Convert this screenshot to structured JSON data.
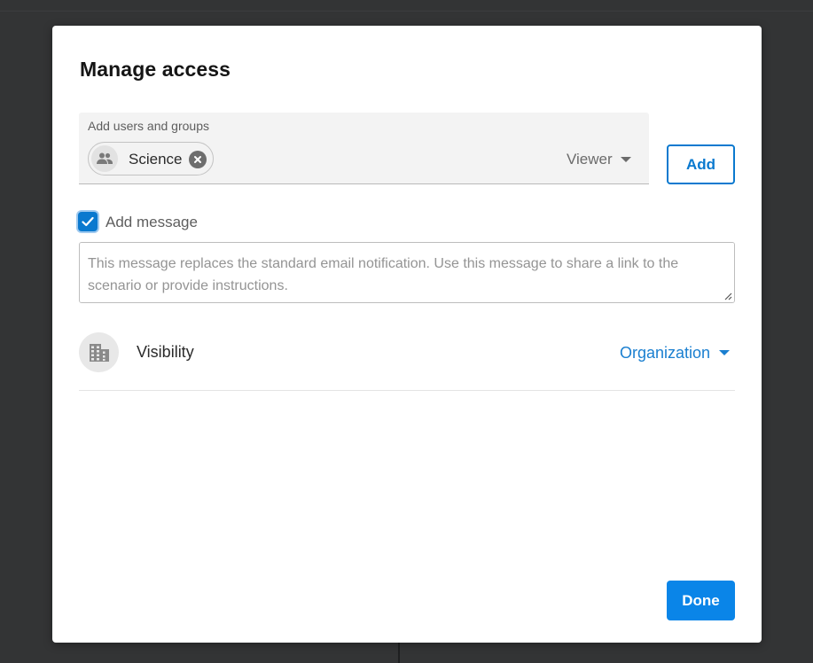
{
  "dialog": {
    "title": "Manage access"
  },
  "picker": {
    "label": "Add users and groups",
    "chips": [
      {
        "label": "Science",
        "icon": "group-icon",
        "remove_icon": "close-circle-icon"
      }
    ],
    "role": "Viewer",
    "add_label": "Add"
  },
  "message": {
    "checkbox_label": "Add message",
    "checked": true,
    "placeholder": "This message replaces the standard email notification. Use this message to share a link to the scenario or provide instructions.",
    "value": ""
  },
  "visibility": {
    "icon": "building-icon",
    "label": "Visibility",
    "value": "Organization"
  },
  "footer": {
    "done_label": "Done"
  },
  "colors": {
    "accent": "#0a79cf",
    "primary_button": "#0a85e8",
    "link": "#1a7fd0",
    "backdrop": "#333435"
  }
}
